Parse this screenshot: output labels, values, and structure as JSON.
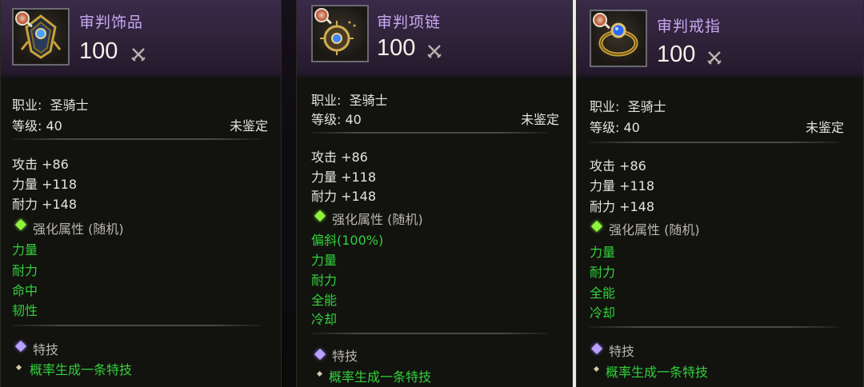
{
  "panels": [
    {
      "name": "审判饰品",
      "power": "100",
      "class_label": "职业:",
      "class_value": "圣骑士",
      "level_label": "等级:",
      "level_value": "40",
      "status": "未鉴定",
      "stats": [
        "攻击 +86",
        "力量 +118",
        "耐力 +148"
      ],
      "enhance_label": "强化属性 (随机)",
      "random_attrs": [
        "力量",
        "耐力",
        "命中",
        "韧性"
      ],
      "skill_label": "特技",
      "skill_desc": "概率生成一条特技",
      "icon": "trinket-icon"
    },
    {
      "name": "审判项链",
      "power": "100",
      "class_label": "职业:",
      "class_value": "圣骑士",
      "level_label": "等级:",
      "level_value": "40",
      "status": "未鉴定",
      "stats": [
        "攻击 +86",
        "力量 +118",
        "耐力 +148"
      ],
      "enhance_label": "强化属性 (随机)",
      "random_attrs": [
        "偏斜(100%)",
        "力量",
        "耐力",
        "全能",
        "冷却"
      ],
      "skill_label": "特技",
      "skill_desc": "概率生成一条特技",
      "icon": "necklace-icon"
    },
    {
      "name": "审判戒指",
      "power": "100",
      "class_label": "职业:",
      "class_value": "圣骑士",
      "level_label": "等级:",
      "level_value": "40",
      "status": "未鉴定",
      "stats": [
        "攻击 +86",
        "力量 +118",
        "耐力 +148"
      ],
      "enhance_label": "强化属性 (随机)",
      "random_attrs": [
        "力量",
        "耐力",
        "全能",
        "冷却"
      ],
      "skill_label": "特技",
      "skill_desc": "概率生成一条特技",
      "icon": "ring-icon"
    }
  ],
  "colors": {
    "header": "#2e2238",
    "name": "#c9a8f0",
    "green_attr": "#32d13a",
    "text": "#e6e4dc",
    "background": "#12120f"
  }
}
